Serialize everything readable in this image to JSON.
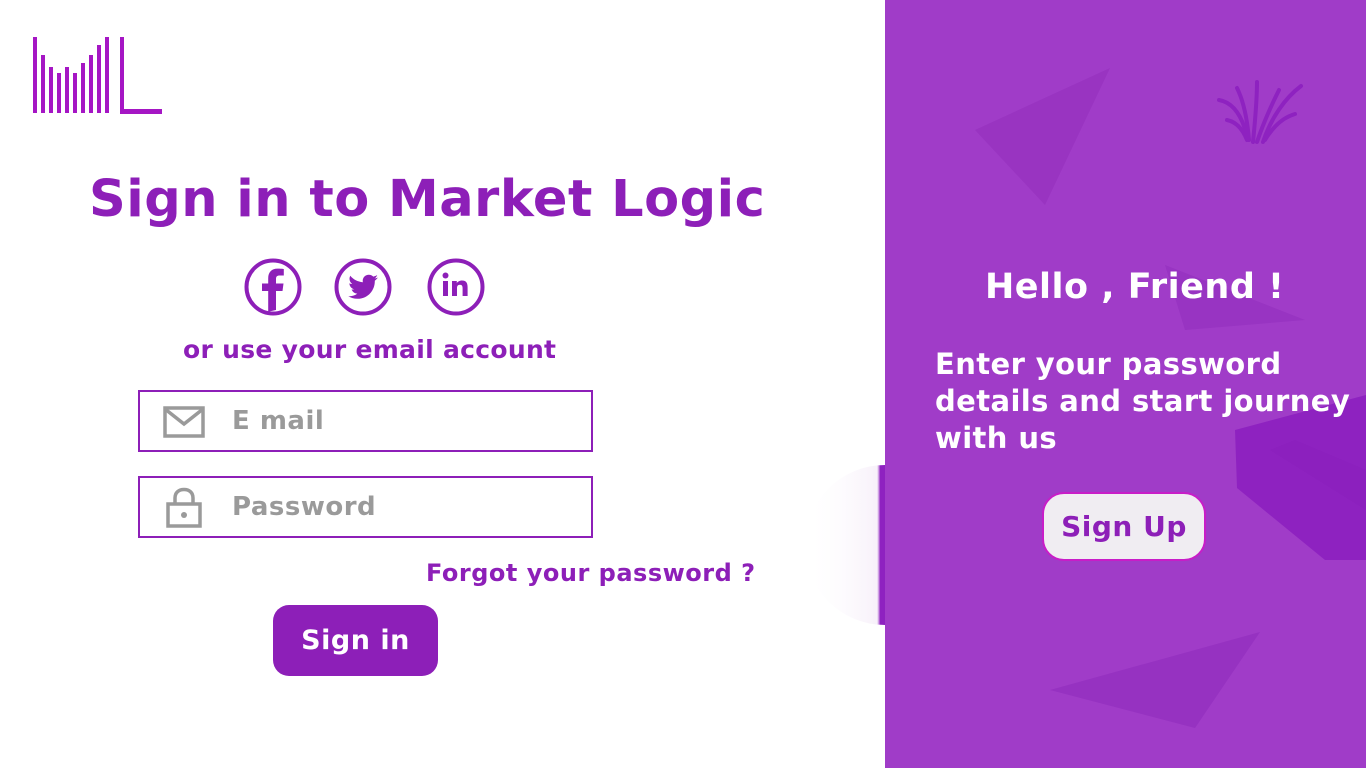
{
  "brand": {
    "logo_icon": "market-logic-bars-logo",
    "primary_color": "#8d1fb8",
    "panel_color": "#a03cc8"
  },
  "signin": {
    "title": "Sign in to Market Logic",
    "social": [
      {
        "name": "facebook",
        "icon": "facebook-icon"
      },
      {
        "name": "twitter",
        "icon": "twitter-icon"
      },
      {
        "name": "linkedin",
        "icon": "linkedin-icon"
      }
    ],
    "alt_text": "or use your email account",
    "email": {
      "placeholder": "E mail",
      "value": "",
      "icon": "mail-icon"
    },
    "password": {
      "placeholder": "Password",
      "value": "",
      "icon": "lock-icon"
    },
    "forgot_label": "Forgot your password ?",
    "button_label": "Sign in"
  },
  "panel": {
    "greeting": "Hello , Friend !",
    "message": "Enter your password details and start journey with us",
    "button_label": "Sign Up",
    "decor_icon": "leaf-icon"
  }
}
